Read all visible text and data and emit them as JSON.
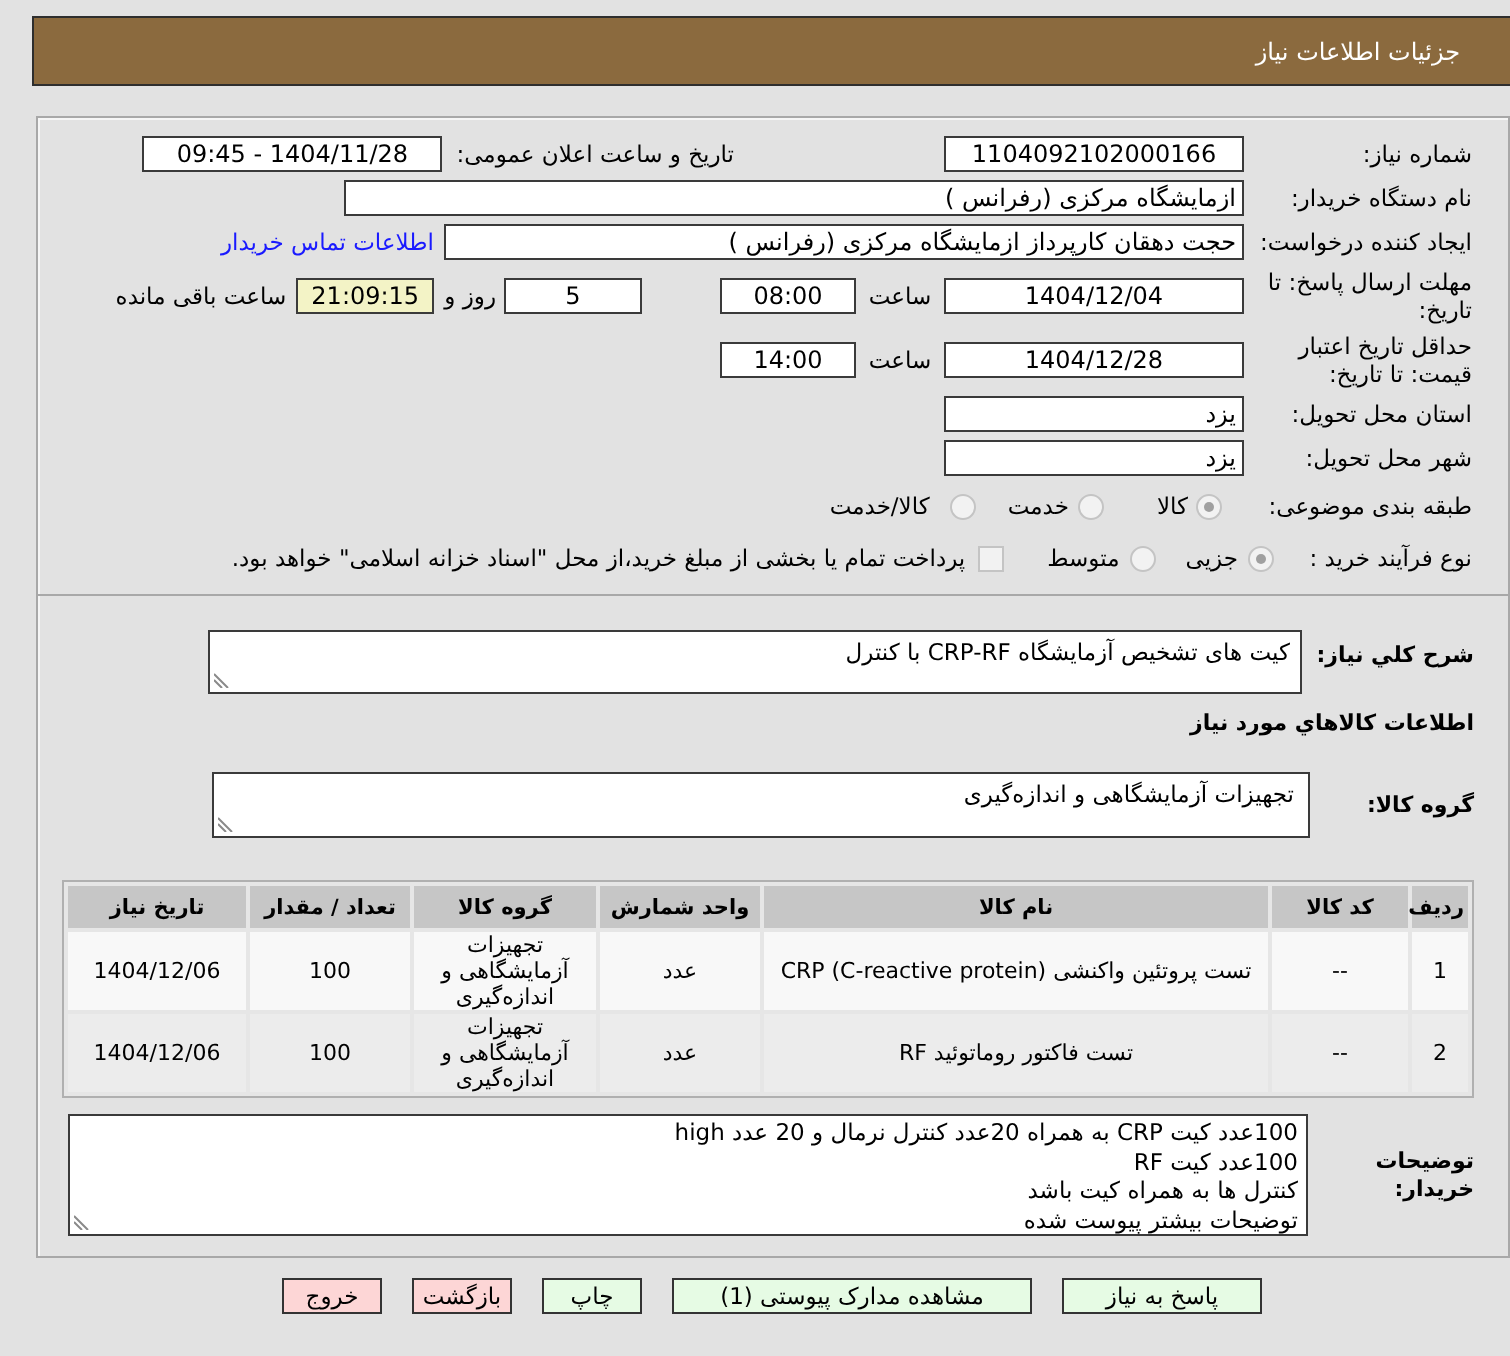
{
  "header": {
    "title": "جزئیات اطلاعات نیاز"
  },
  "details": {
    "need_number": {
      "label": "شماره نیاز:",
      "value": "1104092102000166"
    },
    "announcement": {
      "label": "تاریخ و ساعت اعلان عمومی:",
      "value": "1404/11/28 - 09:45"
    },
    "buyer_org": {
      "label": "نام دستگاه خریدار:",
      "value": "ازمایشگاه مرکزی (رفرانس )"
    },
    "requester": {
      "label": "ایجاد کننده درخواست:",
      "value": "حجت دهقان کارپرداز ازمایشگاه مرکزی (رفرانس )",
      "contact_link": "اطلاعات تماس خریدار"
    },
    "response_deadline": {
      "label": "مهلت ارسال پاسخ: تا تاریخ:",
      "date": "1404/12/04",
      "time_label": "ساعت",
      "time": "08:00",
      "days": "5",
      "days_label": "روز و",
      "remaining": "21:09:15",
      "remaining_label": "ساعت باقی مانده"
    },
    "price_validity": {
      "label": "حداقل تاریخ اعتبار قیمت: تا تاریخ:",
      "date": "1404/12/28",
      "time_label": "ساعت",
      "time": "14:00"
    },
    "delivery_province": {
      "label": "استان محل تحویل:",
      "value": "یزد"
    },
    "delivery_city": {
      "label": "شهر محل تحویل:",
      "value": "یزد"
    },
    "subject_category": {
      "label": "طبقه بندی موضوعی:",
      "options": [
        {
          "label": "کالا",
          "selected": true
        },
        {
          "label": "خدمت",
          "selected": false
        },
        {
          "label": "کالا/خدمت",
          "selected": false
        }
      ]
    },
    "purchase_process": {
      "label": "نوع فرآیند خرید :",
      "options": [
        {
          "label": "جزیی",
          "selected": true
        },
        {
          "label": "متوسط",
          "selected": false
        }
      ],
      "treasury_payment": {
        "label": "پرداخت تمام یا بخشی از مبلغ خرید،از محل \"اسناد خزانه اسلامی\" خواهد بود.",
        "checked": false
      }
    }
  },
  "description": {
    "label": "شرح کلي نياز:",
    "value": "کیت های تشخیص آزمایشگاه CRP-RF با کنترل"
  },
  "goods": {
    "title": "اطلاعات کالاهاي مورد نياز",
    "group": {
      "label": "گروه کالا:",
      "value": "تجهیزات آزمایشگاهی و اندازه‌گیری"
    },
    "table": {
      "columns": [
        "ردیف",
        "کد کالا",
        "نام کالا",
        "واحد شمارش",
        "گروه کالا",
        "تعداد / مقدار",
        "تاریخ نیاز"
      ],
      "rows": [
        {
          "cells": [
            "1",
            "--",
            "تست پروتئین واکنشی CRP (C-reactive protein)",
            "عدد",
            "تجهیزات آزمایشگاهی و اندازه‌گیری",
            "100",
            "1404/12/06"
          ]
        },
        {
          "cells": [
            "2",
            "--",
            "تست فاکتور روماتوئید RF",
            "عدد",
            "تجهیزات آزمایشگاهی و اندازه‌گیری",
            "100",
            "1404/12/06"
          ]
        }
      ]
    }
  },
  "buyer_notes": {
    "label": "توضیحات خریدار:",
    "lines": [
      "100عدد کیت CRP به همراه 20عدد کنترل نرمال و 20 عدد high",
      "100عدد کیت RF",
      "کنترل ها به همراه کیت باشد",
      "توضیحات بیشتر پیوست شده"
    ]
  },
  "buttons": [
    {
      "label": "پاسخ به نیاز",
      "kind": "proceed"
    },
    {
      "label": "مشاهده مدارک پیوستی (1)",
      "kind": "proceed"
    },
    {
      "label": "چاپ",
      "kind": "proceed"
    },
    {
      "label": "بازگشت",
      "kind": "leave"
    },
    {
      "label": "خروج",
      "kind": "leave"
    }
  ]
}
